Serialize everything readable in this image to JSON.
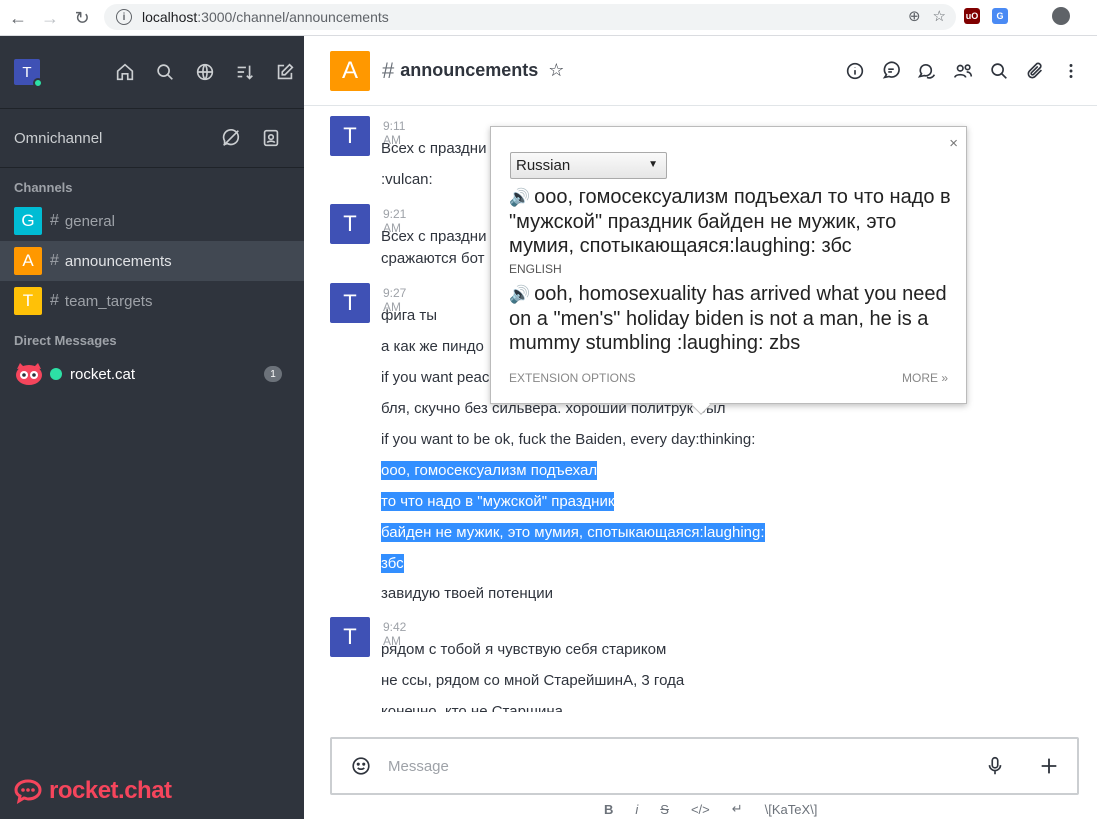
{
  "browser": {
    "url_host": "localhost",
    "url_path": ":3000/channel/announcements"
  },
  "sidebar": {
    "user_initial": "T",
    "omnichannel_label": "Omnichannel",
    "channels_title": "Channels",
    "channels": [
      {
        "initial": "G",
        "name": "general",
        "color": "#00bcd4"
      },
      {
        "initial": "A",
        "name": "announcements",
        "color": "#ff9800"
      },
      {
        "initial": "T",
        "name": "team_targets",
        "color": "#ffc107"
      }
    ],
    "dm_title": "Direct Messages",
    "dms": [
      {
        "name": "rocket.cat",
        "unread": "1"
      }
    ],
    "logo_text": "rocket.chat"
  },
  "room": {
    "initial": "A",
    "name": "announcements"
  },
  "messages": {
    "g1": {
      "initial": "T",
      "time": "9:11 AM",
      "lines": [
        "Всех с праздни",
        ":vulcan:"
      ]
    },
    "g2": {
      "initial": "T",
      "time": "9:21 AM",
      "lines": [
        "Всех с праздни",
        "сражаются бот"
      ]
    },
    "g3": {
      "initial": "T",
      "time": "9:27 AM",
      "lines": [
        "фига ты",
        "а как же пиндо",
        "if you want peac",
        "бля, скучно без сильвера. хороший политрук был",
        "if you want to be ok, fuck the Baiden, every day:thinking:",
        "ооо, гомосексуализм подъехал",
        "то что надо в \"мужской\" праздник",
        "байден не мужик, это мумия, спотыкающаяся:laughing:",
        "збс",
        "завидую твоей потенции"
      ]
    },
    "g4": {
      "initial": "T",
      "time": "9:42 AM",
      "lines": [
        "рядом с тобой я чувствую себя стариком",
        "не ссы, рядом со мной СтарейшинА, 3 года",
        "конечно, кто не Старшина"
      ]
    }
  },
  "composer": {
    "placeholder": "Message",
    "format_bold": "B",
    "format_italic": "i",
    "format_strike": "S",
    "format_katex": "\\[KaTeX\\]"
  },
  "popup": {
    "language": "Russian",
    "close": "×",
    "source_text": "ооо, гомосексуализм подъехал то что надо в \"мужской\" праздник байден не мужик, это мумия, спотыкающаяся:laughing: збс",
    "target_label": "ENGLISH",
    "translation": "ooh, homosexuality has arrived what you need on a \"men's\" holiday biden is not a man, he is a mummy stumbling :laughing: zbs",
    "extension_options": "EXTENSION OPTIONS",
    "more": "MORE »"
  }
}
